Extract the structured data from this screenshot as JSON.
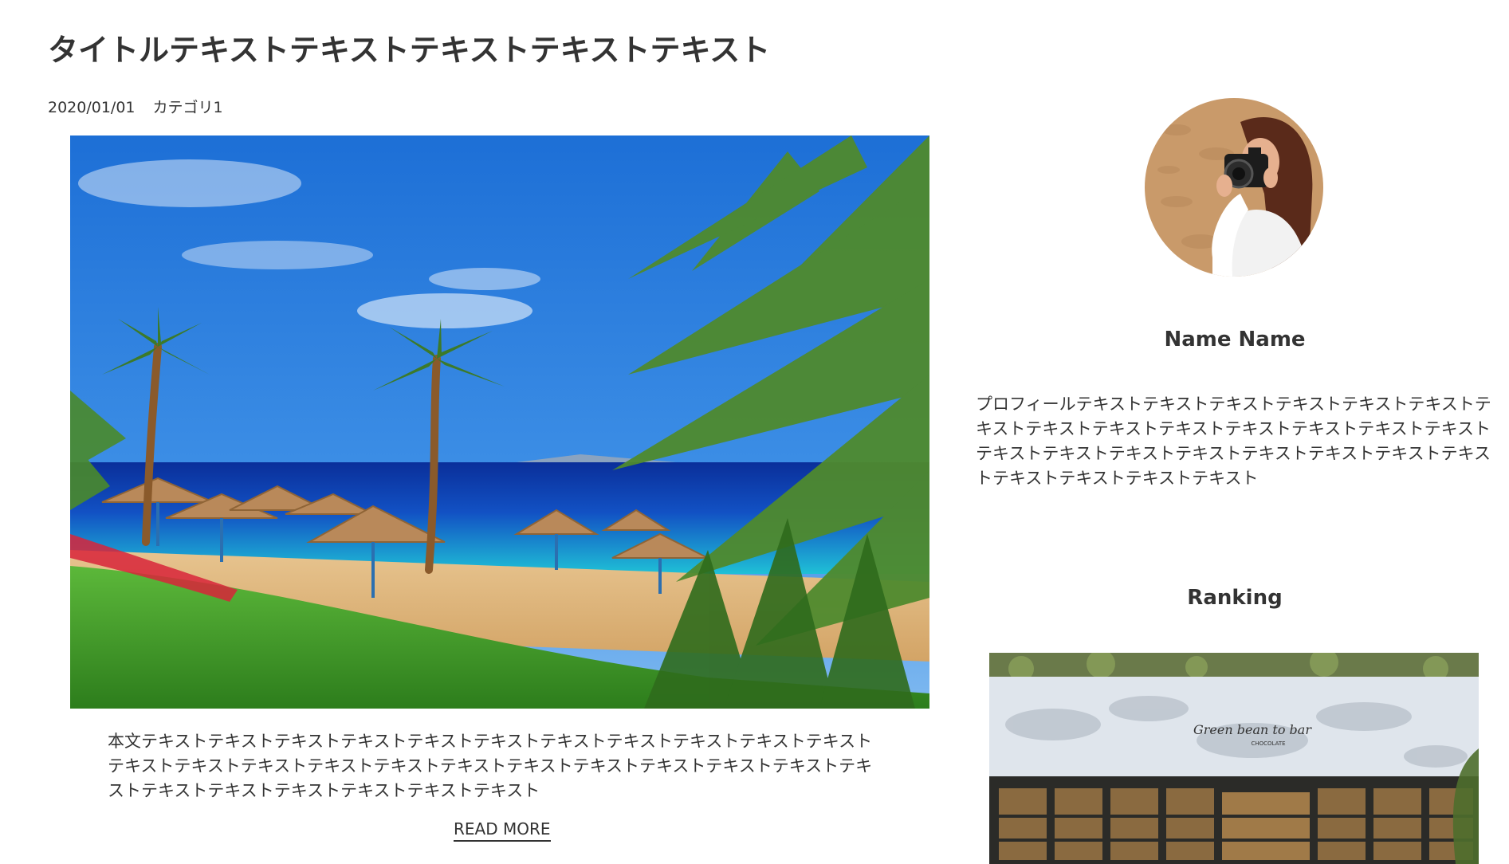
{
  "post": {
    "title": "タイトルテキストテキストテキストテキストテキスト",
    "date": "2020/01/01",
    "category": "カテゴリ1",
    "image": "beach-resort-palm-trees-photo",
    "excerpt": "本文テキストテキストテキストテキストテキストテキストテキストテキストテキストテキストテキストテキストテキストテキストテキストテキストテキストテキストテキストテキストテキストテキストテキストテキストテキストテキストテキストテキストテキスト",
    "read_more_label": "READ MORE"
  },
  "sidebar": {
    "profile": {
      "avatar": "woman-with-camera-photo",
      "name": "Name Name",
      "text": "プロフィールテキストテキストテキストテキストテキストテキストテキストテキストテキストテキストテキストテキストテキストテキストテキストテキストテキストテキストテキストテキストテキストテキストテキストテキストテキストテキスト"
    },
    "ranking": {
      "heading": "Ranking",
      "image": "chocolate-shop-storefront-photo",
      "sign_text": "Green bean to bar CHOCOLATE"
    }
  },
  "colors": {
    "text": "#333333",
    "background": "#ffffff"
  }
}
